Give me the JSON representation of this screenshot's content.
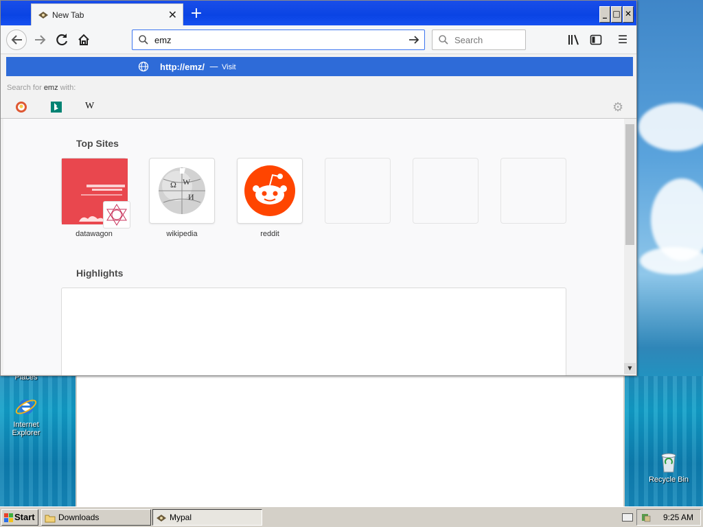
{
  "desktop": {
    "icons": [
      {
        "label": "Places"
      },
      {
        "label": "Internet Explorer"
      },
      {
        "label": "Recycle Bin"
      }
    ]
  },
  "browser": {
    "tab": {
      "title": "New Tab"
    },
    "urlbar": {
      "value": "emz"
    },
    "searchbar": {
      "placeholder": "Search"
    },
    "dropdown": {
      "visit_url": "http://emz/",
      "visit_dash": "—",
      "visit_action": "Visit",
      "search_with_prefix": "Search for",
      "search_term": "emz",
      "search_with_suffix": "with:",
      "engines": [
        "duckduckgo-icon",
        "bing-icon",
        "wikipedia-icon"
      ]
    },
    "newtab": {
      "top_sites_title": "Top Sites",
      "top_sites": [
        {
          "label": "datawagon"
        },
        {
          "label": "wikipedia"
        },
        {
          "label": "reddit"
        },
        {
          "label": ""
        },
        {
          "label": ""
        },
        {
          "label": ""
        }
      ],
      "highlights_title": "Highlights"
    }
  },
  "taskbar": {
    "start_label": "Start",
    "tasks": [
      {
        "label": "Downloads"
      },
      {
        "label": "Mypal"
      }
    ],
    "clock": "9:25 AM"
  },
  "colors": {
    "titlebar": "#0a44e4",
    "visit_row": "#2e6bd8",
    "reddit": "#ff4500",
    "datawagon": "#e9474e"
  }
}
